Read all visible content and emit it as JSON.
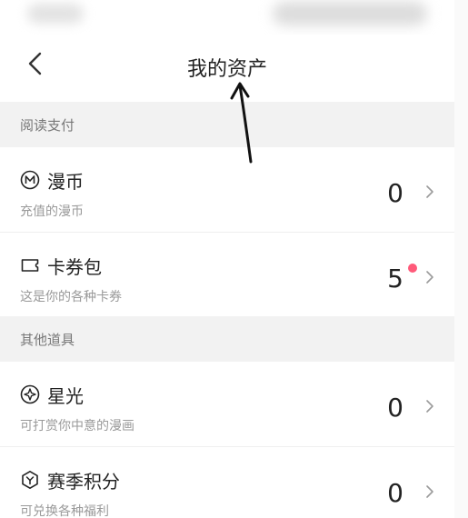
{
  "header": {
    "title": "我的资产"
  },
  "sections": [
    {
      "label": "阅读支付"
    },
    {
      "label": "其他道具"
    }
  ],
  "rows": [
    {
      "icon": "manbi-coin-icon",
      "title": "漫币",
      "subtitle": "充值的漫币",
      "value": "0"
    },
    {
      "icon": "coupon-icon",
      "title": "卡券包",
      "subtitle": "这是你的各种卡券",
      "value": "5",
      "badge": true,
      "badge_color": "#ff5a7a"
    },
    {
      "icon": "starlight-icon",
      "title": "星光",
      "subtitle": "可打赏你中意的漫画",
      "value": "0"
    },
    {
      "icon": "season-points-icon",
      "title": "赛季积分",
      "subtitle": "可兑换各种福利",
      "value": "0"
    }
  ],
  "colors": {
    "section_bg": "#f2f2f2",
    "text": "#222222",
    "subtext": "#9a9a9a",
    "badge": "#ff5a7a"
  }
}
